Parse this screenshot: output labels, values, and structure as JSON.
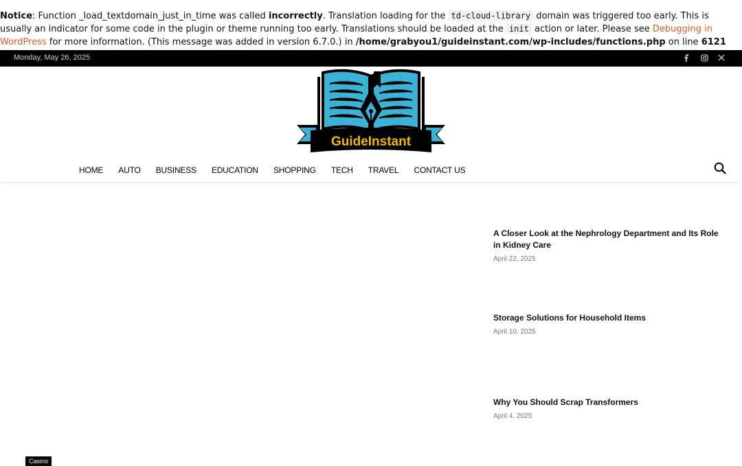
{
  "notice": {
    "label": "Notice",
    "p1": ": Function _load_textdomain_just_in_time was called ",
    "bold1": "incorrectly",
    "p2": ". Translation loading for the ",
    "code1": "td-cloud-library",
    "p3": " domain was triggered too early. This is usually an indicator for some code in the plugin or theme running too early. Translations should be loaded at the ",
    "code2": "init",
    "p4": " action or later. Please see ",
    "link": "Debugging in WordPress",
    "p5": " for more information. (This message was added in version 6.7.0.) in ",
    "path": "/home/grabyou1/guideinstant.com/wp-includes/functions.php",
    "p6": " on line ",
    "line": "6121"
  },
  "topbar": {
    "date": "Monday, May 26, 2025",
    "social": [
      "facebook-icon",
      "instagram-icon",
      "x-icon"
    ]
  },
  "logo": {
    "text": "GuideInstant",
    "colors": {
      "book": "#3bb3d6",
      "ribbon": "#000000",
      "text": "#f5b800"
    }
  },
  "nav": {
    "items": [
      "HOME",
      "AUTO",
      "BUSINESS",
      "EDUCATION",
      "SHOPPING",
      "TECH",
      "TRAVEL",
      "CONTACT US"
    ]
  },
  "posts": [
    {
      "title": "A Closer Look at the Nephrology Department and Its Role in Kidney Care",
      "date": "April 22, 2025"
    },
    {
      "title": "Storage Solutions for Household Items",
      "date": "April 10, 2025"
    },
    {
      "title": "Why You Should Scrap Transformers",
      "date": "April 4, 2025"
    }
  ],
  "tag": "Casino",
  "colors": {
    "link": "#e05c1e",
    "topbar": "#000000"
  }
}
